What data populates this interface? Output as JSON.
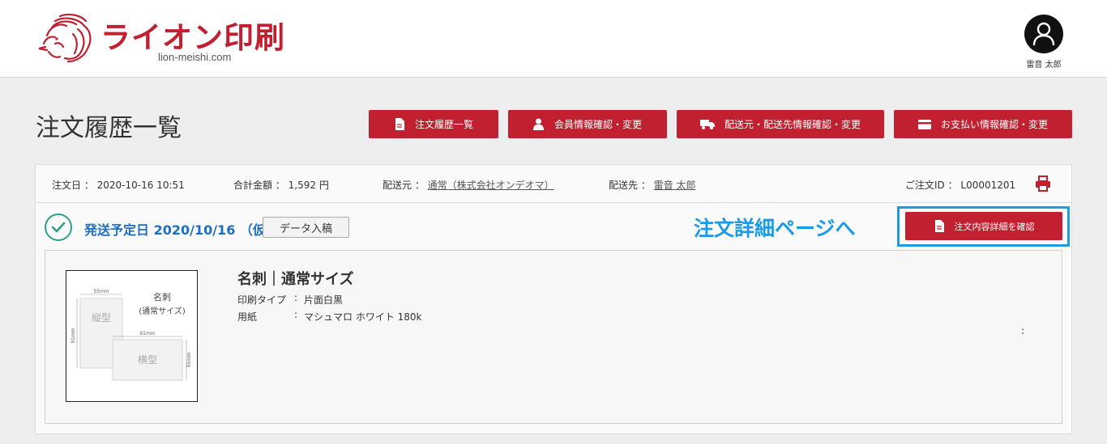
{
  "header": {
    "brand_name": "ライオン印刷",
    "brand_domain": "lion-meishi.com",
    "user_name": "雷音 太郎",
    "brand_color": "#c0202f"
  },
  "page": {
    "title": "注文履歴一覧"
  },
  "nav": {
    "buttons": [
      {
        "label": "注文履歴一覧",
        "icon": "document-icon"
      },
      {
        "label": "会員情報確認・変更",
        "icon": "person-icon"
      },
      {
        "label": "配送元・配送先情報確認・変更",
        "icon": "truck-icon"
      },
      {
        "label": "お支払い情報確認・変更",
        "icon": "credit-card-icon"
      }
    ]
  },
  "order": {
    "date_label": "注文日",
    "date_value": "2020-10-16 10:51",
    "total_label": "合計金額",
    "total_value": "1,592 円",
    "sender_label": "配送元",
    "sender_value": "通常（株式会社オンデオマ）",
    "recipient_label": "配送先",
    "recipient_value": "雷音 太郎",
    "order_id_label": "ご注文ID",
    "order_id_value": "L00001201",
    "colon": "：",
    "status_text": "発送予定日 2020/10/16 （仮）",
    "data_button_label": "データ入稿",
    "annotation_text": "注文詳細ページへ",
    "detail_button_label": "注文内容詳細を確認",
    "annotation_color": "#1a9be6",
    "status_color": "#1e6fbf"
  },
  "item": {
    "product_name": "名刺｜通常サイズ",
    "specs": [
      {
        "label": "印刷タイプ",
        "sep": ":",
        "value": "片面白黒"
      },
      {
        "label": "用紙",
        "sep": ":",
        "value": "マシュマロ ホワイト 180k"
      }
    ],
    "stray_colon": ":",
    "thumb": {
      "title_line1": "名刺",
      "title_line2": "(通常サイズ)",
      "portrait_label": "縦型",
      "landscape_label": "横型",
      "dim_55": "55mm",
      "dim_91": "91mm"
    }
  }
}
